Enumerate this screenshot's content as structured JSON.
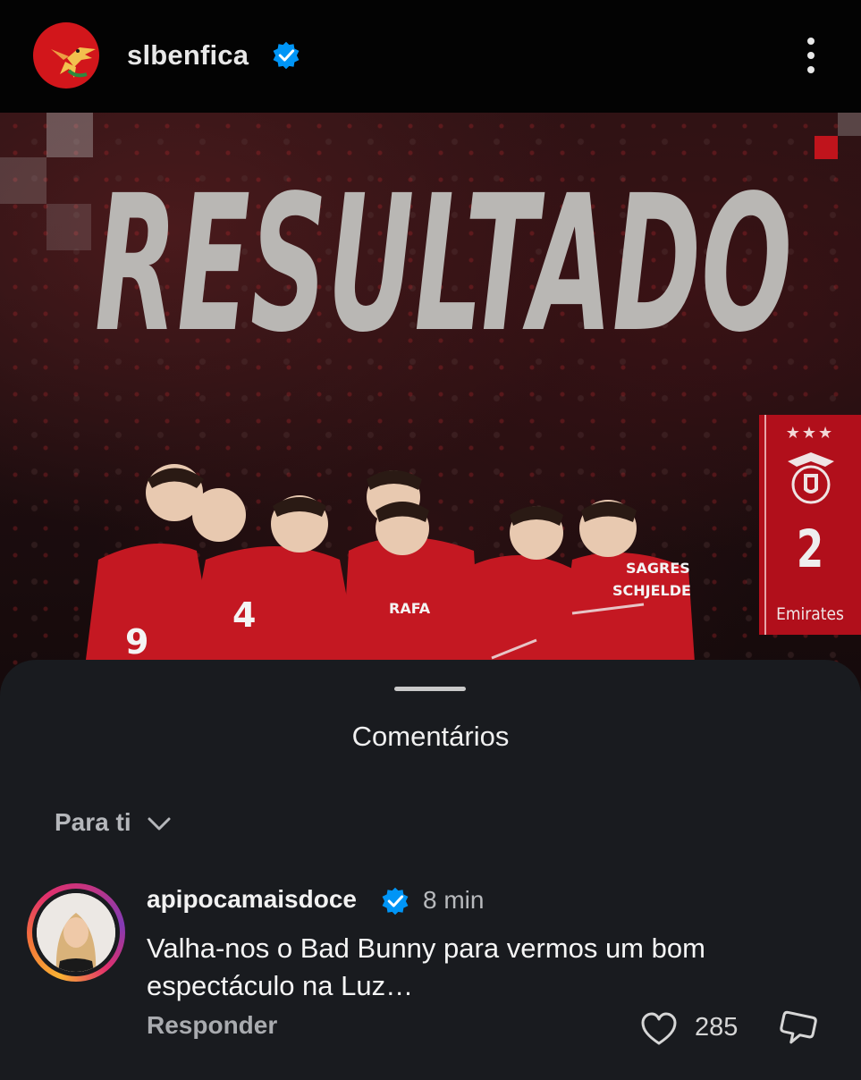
{
  "post": {
    "account": "slbenfica",
    "headline": "RESULTADO",
    "badge": {
      "stars": "★★★",
      "score": "2",
      "sponsor": "Emirates"
    }
  },
  "comments_sheet": {
    "title": "Comentários",
    "filter_label": "Para ti",
    "comment": {
      "username": "apipocamaisdoce",
      "time": "8 min",
      "text": "Valha-nos o Bad Bunny para vermos um bom espectáculo na Luz…",
      "reply_label": "Responder",
      "like_count": "285"
    }
  },
  "colors": {
    "benfica_red": "#d2161b",
    "verified_blue": "#0095f6",
    "sheet_background": "#191b1f"
  },
  "icons": [
    "verified-badge-icon",
    "more-options-icon",
    "chevron-down-icon",
    "heart-icon",
    "reply-bubble-icon"
  ]
}
